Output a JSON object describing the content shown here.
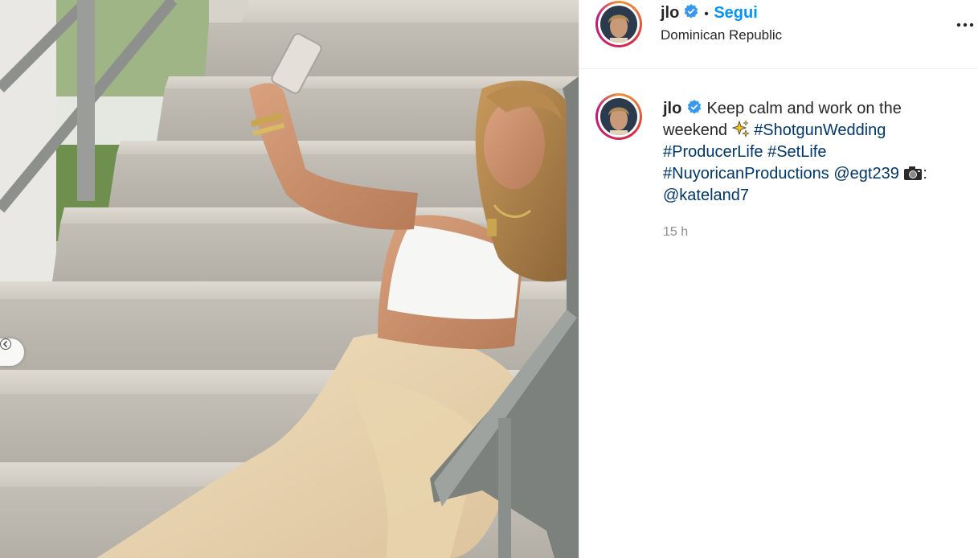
{
  "post": {
    "username": "jlo",
    "follow_label": "Segui",
    "separator": "•",
    "location": "Dominican Republic",
    "more_label": "...",
    "caption": {
      "username": "jlo",
      "text_1": "Keep calm and work on the weekend",
      "emoji_1": "sparkles-icon",
      "tag_1": "#ShotgunWedding",
      "tag_2": "#ProducerLife",
      "tag_3": "#SetLife",
      "tag_4": "#NuyoricanProductions",
      "mention_1": "@egt239",
      "emoji_2": "camera-icon",
      "colon": ":",
      "mention_2": "@kateland7"
    },
    "timestamp": "15 h"
  },
  "colors": {
    "link": "#00376b",
    "follow": "#0095f6",
    "muted": "#8e8e8e",
    "verified": "#3897f0"
  }
}
